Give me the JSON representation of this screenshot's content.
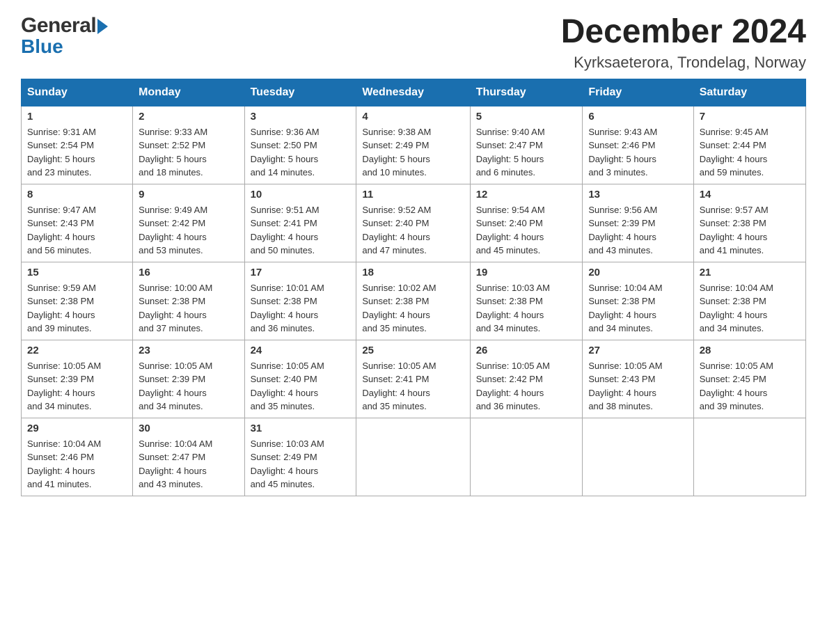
{
  "header": {
    "logo_general": "General",
    "logo_blue": "Blue",
    "main_title": "December 2024",
    "subtitle": "Kyrksaeterora, Trondelag, Norway"
  },
  "days_of_week": [
    "Sunday",
    "Monday",
    "Tuesday",
    "Wednesday",
    "Thursday",
    "Friday",
    "Saturday"
  ],
  "weeks": [
    [
      {
        "day": "1",
        "sunrise": "Sunrise: 9:31 AM",
        "sunset": "Sunset: 2:54 PM",
        "daylight": "Daylight: 5 hours",
        "daylight2": "and 23 minutes."
      },
      {
        "day": "2",
        "sunrise": "Sunrise: 9:33 AM",
        "sunset": "Sunset: 2:52 PM",
        "daylight": "Daylight: 5 hours",
        "daylight2": "and 18 minutes."
      },
      {
        "day": "3",
        "sunrise": "Sunrise: 9:36 AM",
        "sunset": "Sunset: 2:50 PM",
        "daylight": "Daylight: 5 hours",
        "daylight2": "and 14 minutes."
      },
      {
        "day": "4",
        "sunrise": "Sunrise: 9:38 AM",
        "sunset": "Sunset: 2:49 PM",
        "daylight": "Daylight: 5 hours",
        "daylight2": "and 10 minutes."
      },
      {
        "day": "5",
        "sunrise": "Sunrise: 9:40 AM",
        "sunset": "Sunset: 2:47 PM",
        "daylight": "Daylight: 5 hours",
        "daylight2": "and 6 minutes."
      },
      {
        "day": "6",
        "sunrise": "Sunrise: 9:43 AM",
        "sunset": "Sunset: 2:46 PM",
        "daylight": "Daylight: 5 hours",
        "daylight2": "and 3 minutes."
      },
      {
        "day": "7",
        "sunrise": "Sunrise: 9:45 AM",
        "sunset": "Sunset: 2:44 PM",
        "daylight": "Daylight: 4 hours",
        "daylight2": "and 59 minutes."
      }
    ],
    [
      {
        "day": "8",
        "sunrise": "Sunrise: 9:47 AM",
        "sunset": "Sunset: 2:43 PM",
        "daylight": "Daylight: 4 hours",
        "daylight2": "and 56 minutes."
      },
      {
        "day": "9",
        "sunrise": "Sunrise: 9:49 AM",
        "sunset": "Sunset: 2:42 PM",
        "daylight": "Daylight: 4 hours",
        "daylight2": "and 53 minutes."
      },
      {
        "day": "10",
        "sunrise": "Sunrise: 9:51 AM",
        "sunset": "Sunset: 2:41 PM",
        "daylight": "Daylight: 4 hours",
        "daylight2": "and 50 minutes."
      },
      {
        "day": "11",
        "sunrise": "Sunrise: 9:52 AM",
        "sunset": "Sunset: 2:40 PM",
        "daylight": "Daylight: 4 hours",
        "daylight2": "and 47 minutes."
      },
      {
        "day": "12",
        "sunrise": "Sunrise: 9:54 AM",
        "sunset": "Sunset: 2:40 PM",
        "daylight": "Daylight: 4 hours",
        "daylight2": "and 45 minutes."
      },
      {
        "day": "13",
        "sunrise": "Sunrise: 9:56 AM",
        "sunset": "Sunset: 2:39 PM",
        "daylight": "Daylight: 4 hours",
        "daylight2": "and 43 minutes."
      },
      {
        "day": "14",
        "sunrise": "Sunrise: 9:57 AM",
        "sunset": "Sunset: 2:38 PM",
        "daylight": "Daylight: 4 hours",
        "daylight2": "and 41 minutes."
      }
    ],
    [
      {
        "day": "15",
        "sunrise": "Sunrise: 9:59 AM",
        "sunset": "Sunset: 2:38 PM",
        "daylight": "Daylight: 4 hours",
        "daylight2": "and 39 minutes."
      },
      {
        "day": "16",
        "sunrise": "Sunrise: 10:00 AM",
        "sunset": "Sunset: 2:38 PM",
        "daylight": "Daylight: 4 hours",
        "daylight2": "and 37 minutes."
      },
      {
        "day": "17",
        "sunrise": "Sunrise: 10:01 AM",
        "sunset": "Sunset: 2:38 PM",
        "daylight": "Daylight: 4 hours",
        "daylight2": "and 36 minutes."
      },
      {
        "day": "18",
        "sunrise": "Sunrise: 10:02 AM",
        "sunset": "Sunset: 2:38 PM",
        "daylight": "Daylight: 4 hours",
        "daylight2": "and 35 minutes."
      },
      {
        "day": "19",
        "sunrise": "Sunrise: 10:03 AM",
        "sunset": "Sunset: 2:38 PM",
        "daylight": "Daylight: 4 hours",
        "daylight2": "and 34 minutes."
      },
      {
        "day": "20",
        "sunrise": "Sunrise: 10:04 AM",
        "sunset": "Sunset: 2:38 PM",
        "daylight": "Daylight: 4 hours",
        "daylight2": "and 34 minutes."
      },
      {
        "day": "21",
        "sunrise": "Sunrise: 10:04 AM",
        "sunset": "Sunset: 2:38 PM",
        "daylight": "Daylight: 4 hours",
        "daylight2": "and 34 minutes."
      }
    ],
    [
      {
        "day": "22",
        "sunrise": "Sunrise: 10:05 AM",
        "sunset": "Sunset: 2:39 PM",
        "daylight": "Daylight: 4 hours",
        "daylight2": "and 34 minutes."
      },
      {
        "day": "23",
        "sunrise": "Sunrise: 10:05 AM",
        "sunset": "Sunset: 2:39 PM",
        "daylight": "Daylight: 4 hours",
        "daylight2": "and 34 minutes."
      },
      {
        "day": "24",
        "sunrise": "Sunrise: 10:05 AM",
        "sunset": "Sunset: 2:40 PM",
        "daylight": "Daylight: 4 hours",
        "daylight2": "and 35 minutes."
      },
      {
        "day": "25",
        "sunrise": "Sunrise: 10:05 AM",
        "sunset": "Sunset: 2:41 PM",
        "daylight": "Daylight: 4 hours",
        "daylight2": "and 35 minutes."
      },
      {
        "day": "26",
        "sunrise": "Sunrise: 10:05 AM",
        "sunset": "Sunset: 2:42 PM",
        "daylight": "Daylight: 4 hours",
        "daylight2": "and 36 minutes."
      },
      {
        "day": "27",
        "sunrise": "Sunrise: 10:05 AM",
        "sunset": "Sunset: 2:43 PM",
        "daylight": "Daylight: 4 hours",
        "daylight2": "and 38 minutes."
      },
      {
        "day": "28",
        "sunrise": "Sunrise: 10:05 AM",
        "sunset": "Sunset: 2:45 PM",
        "daylight": "Daylight: 4 hours",
        "daylight2": "and 39 minutes."
      }
    ],
    [
      {
        "day": "29",
        "sunrise": "Sunrise: 10:04 AM",
        "sunset": "Sunset: 2:46 PM",
        "daylight": "Daylight: 4 hours",
        "daylight2": "and 41 minutes."
      },
      {
        "day": "30",
        "sunrise": "Sunrise: 10:04 AM",
        "sunset": "Sunset: 2:47 PM",
        "daylight": "Daylight: 4 hours",
        "daylight2": "and 43 minutes."
      },
      {
        "day": "31",
        "sunrise": "Sunrise: 10:03 AM",
        "sunset": "Sunset: 2:49 PM",
        "daylight": "Daylight: 4 hours",
        "daylight2": "and 45 minutes."
      },
      null,
      null,
      null,
      null
    ]
  ]
}
